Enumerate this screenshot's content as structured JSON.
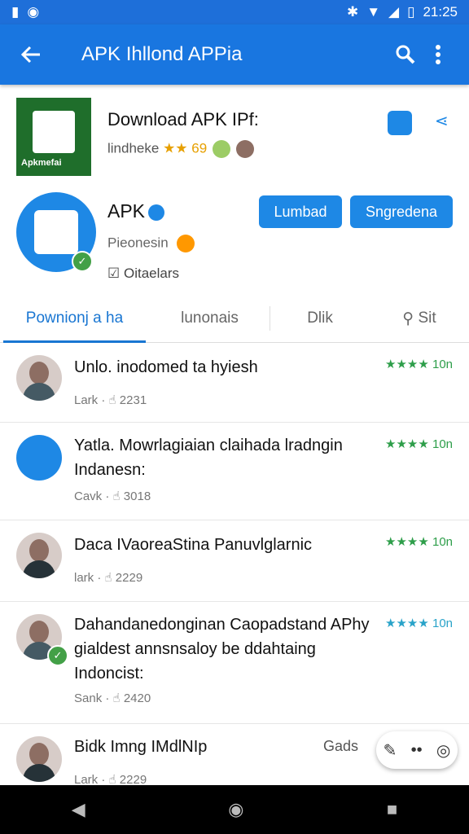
{
  "status_bar": {
    "time": "21:25"
  },
  "app_bar": {
    "title": "APK Ihllond APPia"
  },
  "app": {
    "title": "Download APK IPf:",
    "subtitle": "lindheke",
    "rating_text": "★★ 69"
  },
  "profile": {
    "name": "APK",
    "subtitle": "Pieonesin",
    "check_label": "Oitaelars",
    "button_primary": "Lumbad",
    "button_secondary": "Sngredena"
  },
  "tabs": [
    "Pownionj a ha",
    "lunonais",
    "Dlik",
    "Sit"
  ],
  "posts": [
    {
      "text": "Unlo. inodomed ta hyiesh",
      "meta": "Lark · ☝ 2231",
      "score": "★★★★ 10n"
    },
    {
      "text": "Yatla. Mowrlagiaian claihada lradngin\nIndanesn:",
      "meta": "Cavk · ☝ 3018",
      "score": "★★★★ 10n"
    },
    {
      "text": "Daca IVaoreaStina Panuvlglarnic",
      "meta": "lark · ☝ 2229",
      "score": "★★★★ 10n"
    },
    {
      "text": "Dahandanedonginan Caopadstand APhy\ngialdest annsnsaloy be ddahtaing\nIndoncist:",
      "meta": "Sank · ☝ 2420",
      "score": "★★★★ 10n"
    },
    {
      "text": "Bidk Imng IMdlNIp",
      "meta": "Lark · ☝ 2229",
      "score": "Gads"
    }
  ],
  "colors": {
    "primary": "#1976e0",
    "green": "#2e9e4a"
  }
}
